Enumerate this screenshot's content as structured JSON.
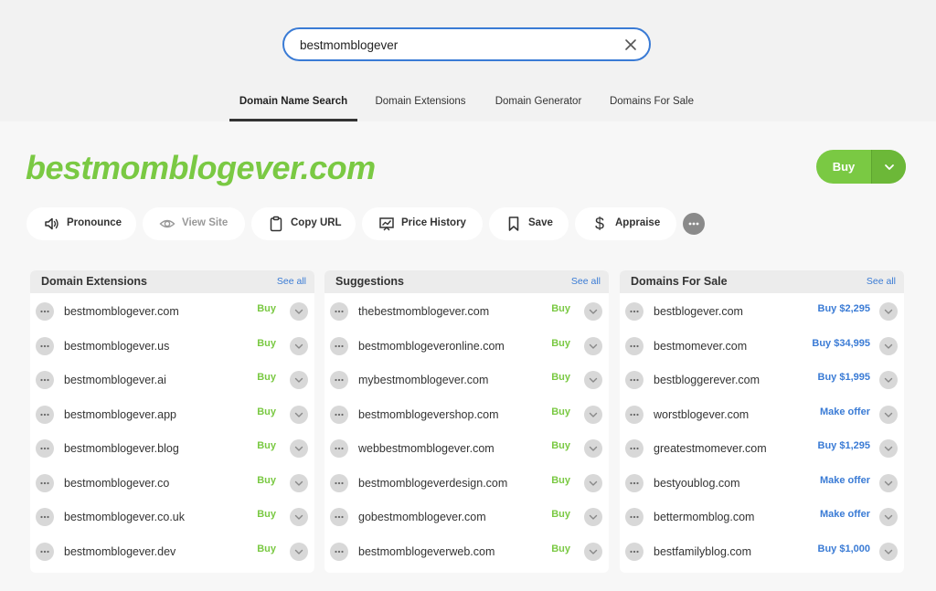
{
  "search": {
    "value": "bestmomblogever",
    "placeholder": ""
  },
  "tabs": [
    {
      "label": "Domain Name Search"
    },
    {
      "label": "Domain Extensions"
    },
    {
      "label": "Domain Generator"
    },
    {
      "label": "Domains For Sale"
    }
  ],
  "domain": {
    "name": "bestmomblogever.com"
  },
  "buy_button": {
    "label": "Buy"
  },
  "actions": [
    {
      "label": "Pronounce",
      "icon": "speaker-icon"
    },
    {
      "label": "View Site",
      "icon": "eye-icon"
    },
    {
      "label": "Copy URL",
      "icon": "clipboard-icon"
    },
    {
      "label": "Price History",
      "icon": "chart-icon"
    },
    {
      "label": "Save",
      "icon": "bookmark-icon"
    },
    {
      "label": "Appraise",
      "icon": "dollar-icon"
    }
  ],
  "panels": {
    "extensions": {
      "title": "Domain Extensions",
      "see_all": "See all",
      "rows": [
        {
          "name": "bestmomblogever.com",
          "price": "Buy"
        },
        {
          "name": "bestmomblogever.us",
          "price": "Buy"
        },
        {
          "name": "bestmomblogever.ai",
          "price": "Buy"
        },
        {
          "name": "bestmomblogever.app",
          "price": "Buy"
        },
        {
          "name": "bestmomblogever.blog",
          "price": "Buy"
        },
        {
          "name": "bestmomblogever.co",
          "price": "Buy"
        },
        {
          "name": "bestmomblogever.co.uk",
          "price": "Buy"
        },
        {
          "name": "bestmomblogever.dev",
          "price": "Buy"
        }
      ]
    },
    "suggestions": {
      "title": "Suggestions",
      "see_all": "See all",
      "rows": [
        {
          "name": "thebestmomblogever.com",
          "price": "Buy"
        },
        {
          "name": "bestmomblogeveronline.com",
          "price": "Buy"
        },
        {
          "name": "mybestmomblogever.com",
          "price": "Buy"
        },
        {
          "name": "bestmomblogevershop.com",
          "price": "Buy"
        },
        {
          "name": "webbestmomblogever.com",
          "price": "Buy"
        },
        {
          "name": "bestmomblogeverdesign.com",
          "price": "Buy"
        },
        {
          "name": "gobestmomblogever.com",
          "price": "Buy"
        },
        {
          "name": "bestmomblogeverweb.com",
          "price": "Buy"
        }
      ]
    },
    "for_sale": {
      "title": "Domains For Sale",
      "see_all": "See all",
      "rows": [
        {
          "name": "bestblogever.com",
          "price": "Buy $2,295"
        },
        {
          "name": "bestmomever.com",
          "price": "Buy $34,995"
        },
        {
          "name": "bestbloggerever.com",
          "price": "Buy $1,995"
        },
        {
          "name": "worstblogever.com",
          "price": "Make offer"
        },
        {
          "name": "greatestmomever.com",
          "price": "Buy $1,295"
        },
        {
          "name": "bestyoublog.com",
          "price": "Make offer"
        },
        {
          "name": "bettermomblog.com",
          "price": "Make offer"
        },
        {
          "name": "bestfamilyblog.com",
          "price": "Buy $1,000"
        }
      ]
    }
  },
  "colors": {
    "brand_green": "#7ac943",
    "link_blue": "#3a7bd5",
    "focus_blue": "#3a7bd5"
  }
}
